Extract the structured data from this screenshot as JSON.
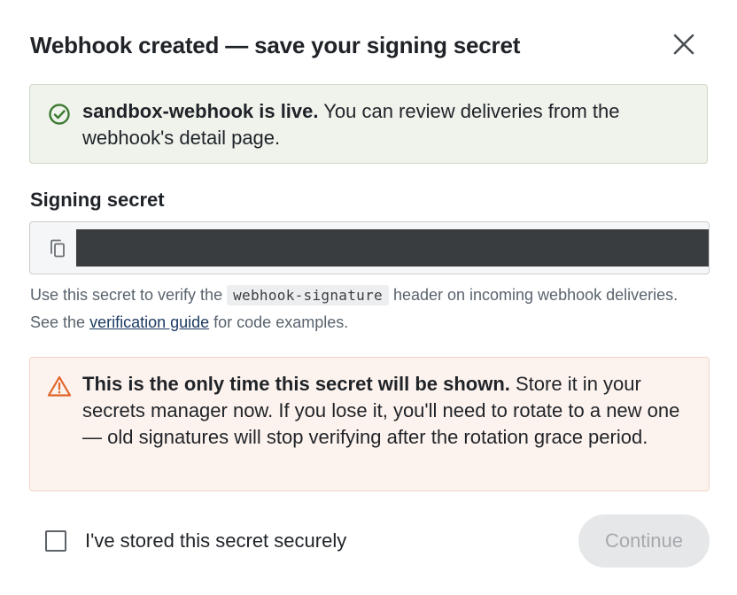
{
  "dialog": {
    "title": "Webhook created — save your signing secret",
    "close_icon": "close-icon"
  },
  "success_banner": {
    "icon": "check-circle-icon",
    "strong": "sandbox-webhook is live.",
    "text": " You can review deliveries from the webhook's detail page."
  },
  "secret": {
    "label": "Signing secret",
    "copy_icon": "copy-icon",
    "masked": true
  },
  "help": {
    "before": "Use this secret to verify the ",
    "code": "webhook-signature",
    "middle": " header on incoming webhook deliveries. See the ",
    "link": "verification guide",
    "after": " for code examples."
  },
  "warning_banner": {
    "icon": "warning-triangle-icon",
    "strong": "This is the only time this secret will be shown.",
    "text": " Store it in your secrets manager now. If you lose it, you'll need to rotate to a new one — old signatures will stop verifying after the rotation grace period."
  },
  "confirm": {
    "checked": false,
    "label": "I've stored this secret securely"
  },
  "actions": {
    "continue_label": "Continue",
    "continue_disabled": true
  },
  "colors": {
    "success_icon": "#3d7a32",
    "warning_icon": "#e0652a",
    "link": "#1d3b63"
  }
}
